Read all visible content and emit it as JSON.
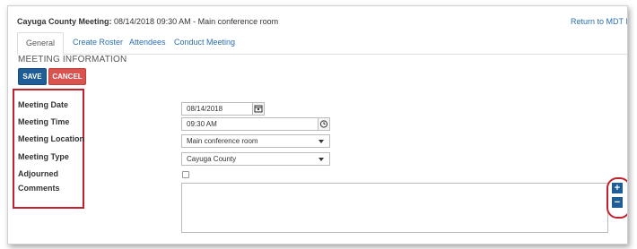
{
  "header": {
    "meeting_title_bold": "Cayuga County Meeting:",
    "meeting_title_rest": " 08/14/2018 09:30 AM - Main conference room",
    "return_link": "Return to MDT Me"
  },
  "tabs": [
    {
      "label": "General",
      "active": true
    },
    {
      "label": "Create Roster",
      "active": false
    },
    {
      "label": "Attendees",
      "active": false
    },
    {
      "label": "Conduct Meeting",
      "active": false
    }
  ],
  "section_title": "MEETING INFORMATION",
  "buttons": {
    "save": "SAVE",
    "cancel": "CANCEL"
  },
  "fields": {
    "meeting_date": {
      "label": "Meeting Date",
      "value": "08/14/2018"
    },
    "meeting_time": {
      "label": "Meeting Time",
      "value": "09:30 AM"
    },
    "meeting_location": {
      "label": "Meeting Location",
      "value": "Main conference room"
    },
    "meeting_type": {
      "label": "Meeting Type",
      "value": "Cayuga County"
    },
    "adjourned": {
      "label": "Adjourned",
      "checked": false
    },
    "comments": {
      "label": "Comments",
      "value": ""
    }
  },
  "controls": {
    "add": "+",
    "remove": "−"
  },
  "colors": {
    "link": "#2a6eb0",
    "save_button": "#1f5d96",
    "cancel_button": "#d9534f",
    "highlight_annotation": "#c0212c"
  },
  "icons": {
    "date_picker": "calendar-icon",
    "time_picker": "clock-icon",
    "dropdown": "chevron-down-icon"
  }
}
